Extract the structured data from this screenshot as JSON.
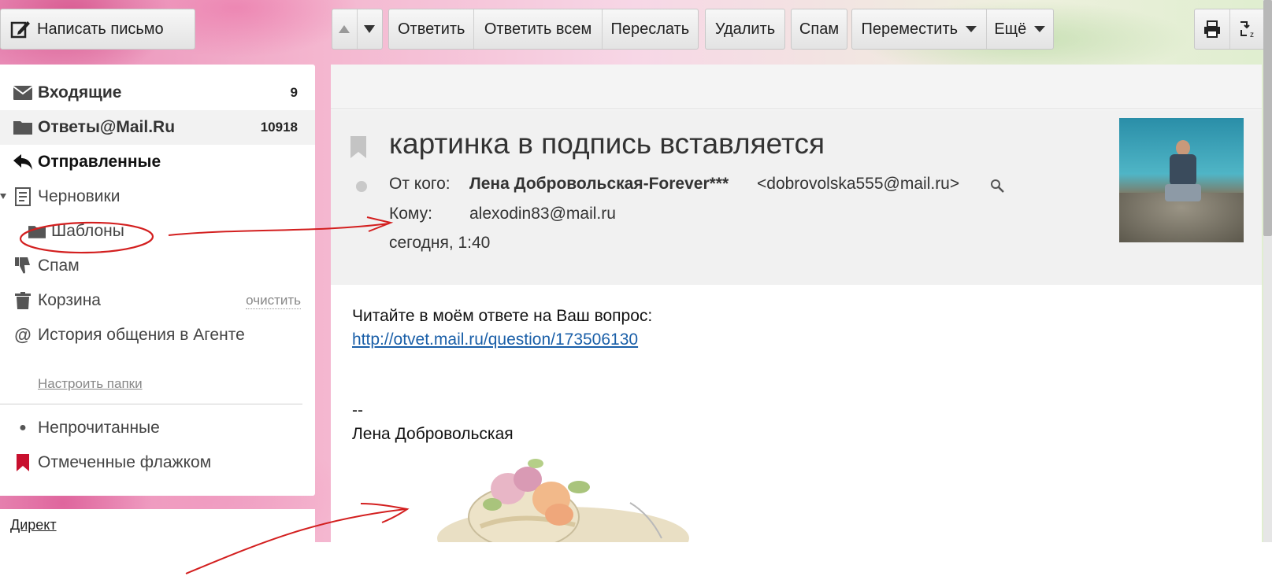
{
  "toolbar": {
    "compose_label": "Написать письмо",
    "reply": "Ответить",
    "reply_all": "Ответить всем",
    "forward": "Переслать",
    "delete": "Удалить",
    "spam": "Спам",
    "move": "Переместить",
    "more": "Ещё"
  },
  "sidebar": {
    "folders": [
      {
        "label": "Входящие",
        "count": "9",
        "icon": "envelope-icon"
      },
      {
        "label": "Ответы@Mail.Ru",
        "count": "10918",
        "icon": "folder-icon"
      },
      {
        "label": "Отправленные",
        "count": "",
        "icon": "reply-icon"
      },
      {
        "label": "Черновики",
        "count": "",
        "icon": "draft-icon"
      },
      {
        "label": "Шаблоны",
        "count": "",
        "icon": "folder-icon"
      },
      {
        "label": "Спам",
        "count": "",
        "icon": "thumbs-down-icon"
      },
      {
        "label": "Корзина",
        "count": "",
        "icon": "trash-icon",
        "action": "очистить"
      },
      {
        "label": "История общения в Агенте",
        "count": "",
        "icon": "at-icon"
      }
    ],
    "configure_folders": "Настроить папки",
    "filters": [
      {
        "label": "Непрочитанные",
        "icon": "dot-icon"
      },
      {
        "label": "Отмеченные флажком",
        "icon": "flag-icon"
      }
    ],
    "direct_link": "Директ"
  },
  "message": {
    "subject": "картинка в подпись вставляется",
    "from_label": "От кого:",
    "from_name": "Лена Добровольская-Forever***",
    "from_email": "<dobrovolska555@mail.ru>",
    "to_label": "Кому:",
    "to_value": "alexodin83@mail.ru",
    "date": "сегодня, 1:40",
    "body_line1": "Читайте в моём ответе на Ваш вопрос:",
    "body_link": "http://otvet.mail.ru/question/173506130",
    "signature_sep": "--",
    "signature_name": "Лена Добровольская"
  },
  "colors": {
    "annotation_red": "#d31f1f",
    "link_blue": "#1a5fa8",
    "flag_red": "#c8102e"
  }
}
